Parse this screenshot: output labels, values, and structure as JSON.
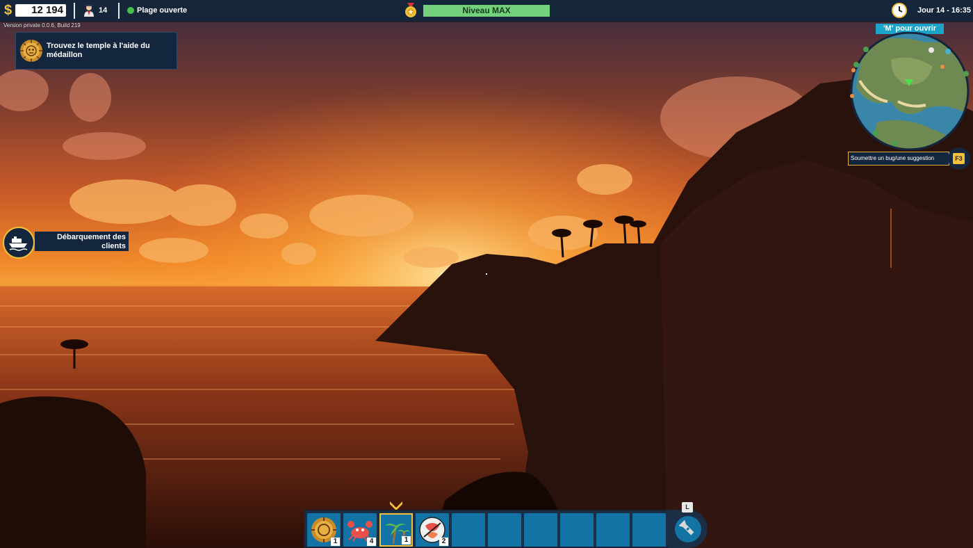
{
  "hud": {
    "currency_symbol": "$",
    "money": "12 194",
    "staff_count": "14",
    "beach_status": "Plage ouverte",
    "level": "Niveau MAX",
    "day": "Jour 14 - 16:35",
    "version": "Version private 0.0.6, Build 219"
  },
  "quest": {
    "text": "Trouvez le temple à l'aide du médaillon",
    "icon": "medallion-icon"
  },
  "event": {
    "text": "Débarquement des clients",
    "icon": "boat-icon"
  },
  "minimap": {
    "hint": "'M' pour ouvrir"
  },
  "bug_report": {
    "label": "Soumettre un bug/une suggestion",
    "key": "F3"
  },
  "hotbar": {
    "selected_index": 2,
    "tool_key": "L",
    "tool_icon": "flashlight-icon",
    "slots": [
      {
        "item": "medallion-icon",
        "count": "1"
      },
      {
        "item": "crab-icon",
        "count": "4"
      },
      {
        "item": "palm-tree-icon",
        "count": "1"
      },
      {
        "item": "seafood-plate-icon",
        "count": "2"
      },
      {
        "item": "",
        "count": ""
      },
      {
        "item": "",
        "count": ""
      },
      {
        "item": "",
        "count": ""
      },
      {
        "item": "",
        "count": ""
      },
      {
        "item": "",
        "count": ""
      },
      {
        "item": "",
        "count": ""
      }
    ]
  },
  "colors": {
    "hud_bg": "#15263a",
    "accent_gold": "#f2c13a",
    "level_green": "#72d17a",
    "slot_blue": "#1373a5",
    "map_hint_cyan": "#1ca3c9"
  }
}
